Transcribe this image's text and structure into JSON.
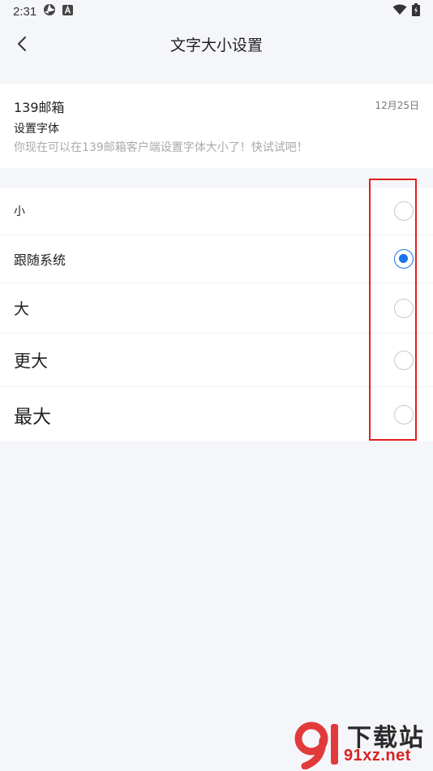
{
  "status_bar": {
    "time": "2:31"
  },
  "nav": {
    "title": "文字大小设置"
  },
  "preview": {
    "sender": "139邮箱",
    "date": "12月25日",
    "subject": "设置字体",
    "summary": "你现在可以在139邮箱客户端设置字体大小了！快试试吧！"
  },
  "font_options": [
    {
      "label": "小",
      "selected": false
    },
    {
      "label": "跟随系统",
      "selected": true
    },
    {
      "label": "大",
      "selected": false
    },
    {
      "label": "更大",
      "selected": false
    },
    {
      "label": "最大",
      "selected": false
    }
  ],
  "colors": {
    "accent": "#1a73e8",
    "highlight": "#e02020",
    "background": "#f5f6fa"
  },
  "watermark": {
    "top_text": "下载站",
    "bottom_text": "91xz.net"
  }
}
